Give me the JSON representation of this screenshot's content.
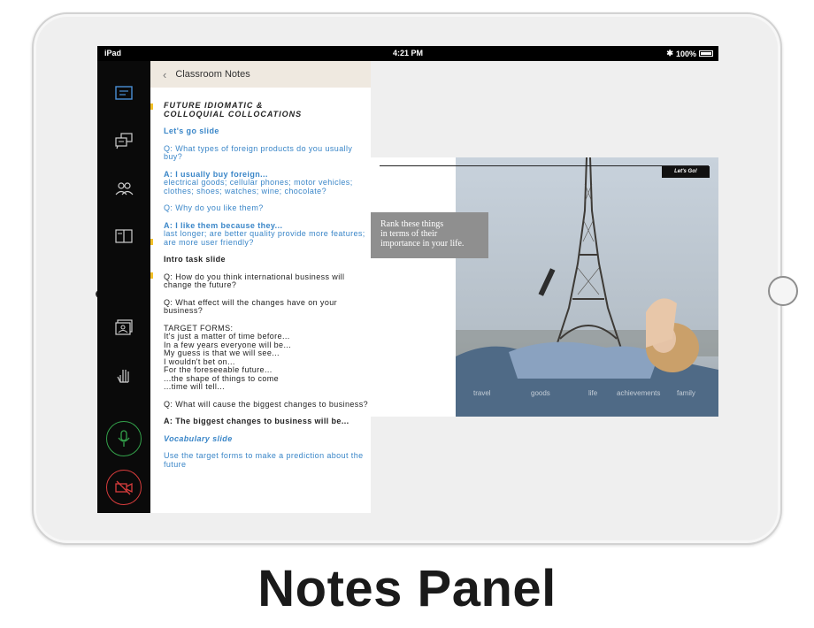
{
  "statusbar": {
    "device": "iPad",
    "time": "4:21 PM",
    "battery": "100%"
  },
  "notes": {
    "header_title": "Classroom Notes",
    "blocks": [
      {
        "text": "FUTURE IDIOMATIC &\nCOLLOQUIAL COLLOCATIONS",
        "style": "title"
      },
      {
        "text": "Let's go slide",
        "style": "blue-bold"
      },
      {
        "text": "Q: What types of foreign products do you usually buy?",
        "style": "blue"
      },
      {
        "text": "A: I usually buy foreign...",
        "style": "blue-bold"
      },
      {
        "text": "electrical goods; cellular phones; motor vehicles; clothes; shoes; watches; wine; chocolate?",
        "style": "blue"
      },
      {
        "text": "Q: Why do you like them?",
        "style": "blue"
      },
      {
        "text": "A: I like them because they...",
        "style": "blue-bold"
      },
      {
        "text": "last longer; are better quality provide more features; are more user friendly?",
        "style": "blue"
      },
      {
        "text": "Intro task slide",
        "style": "bold"
      },
      {
        "text": "Q: How do you think international business will change the future?",
        "style": "plain"
      },
      {
        "text": "Q: What effect will the changes have on your business?",
        "style": "plain"
      },
      {
        "text": "TARGET FORMS:\nIt's just a matter of time before...\nIn a few years everyone will be...\nMy guess is that we will see...\nI wouldn't bet on...\nFor the foreseeable future...\n...the shape of things to come\n...time will tell...",
        "style": "plain"
      },
      {
        "text": "Q: What will cause the biggest changes to business?",
        "style": "plain"
      },
      {
        "text": "A: The biggest changes to business will be...",
        "style": "bold"
      },
      {
        "text": "Vocabulary slide",
        "style": "blue-italic"
      },
      {
        "text": "Use the target forms to make a prediction about the future",
        "style": "blue"
      }
    ]
  },
  "slide": {
    "badge": "Let's Go!",
    "prompt": "Rank these things\nin terms of their\nimportance in your life.",
    "captions": [
      "travel",
      "goods",
      "life",
      "achievements",
      "family"
    ]
  },
  "footer_title": "Notes Panel",
  "colors": {
    "accent_blue": "#3a86c8",
    "mic_green": "#33a04a",
    "camera_red": "#d83c3c",
    "header_beige": "#efe9e0"
  }
}
